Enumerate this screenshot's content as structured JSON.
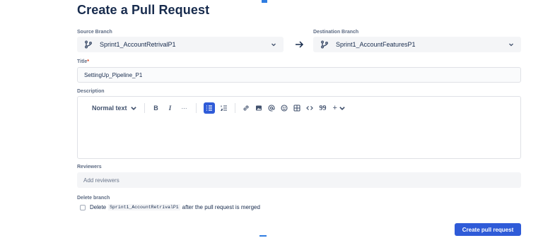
{
  "page": {
    "title": "Create a Pull Request"
  },
  "source_branch": {
    "label": "Source Branch",
    "value": "Sprint1_AccountRetrivalP1",
    "icon": "branch-icon"
  },
  "destination_branch": {
    "label": "Destination Branch",
    "value": "Sprint1_AccountFeaturesP1",
    "icon": "branch-icon"
  },
  "title_field": {
    "label": "Title",
    "required_mark": "*",
    "value": "SettingUp_Pipeline_P1"
  },
  "description": {
    "label": "Description",
    "toolbar": {
      "text_style": "Normal text",
      "bold": "B",
      "italic": "I",
      "more": "···",
      "quote": "99",
      "insert": "+"
    }
  },
  "reviewers": {
    "label": "Reviewers",
    "placeholder": "Add reviewers"
  },
  "delete_branch": {
    "label": "Delete branch",
    "prefix": "Delete",
    "branch": "Sprint1_AccountRetrivalP1",
    "suffix": "after the pull request is merged",
    "checked": false
  },
  "actions": {
    "create_label": "Create pull request"
  },
  "colors": {
    "accent": "#2f5bd8",
    "text": "#172b4d",
    "muted": "#5e6c84",
    "field_bg": "#f4f5f7"
  }
}
